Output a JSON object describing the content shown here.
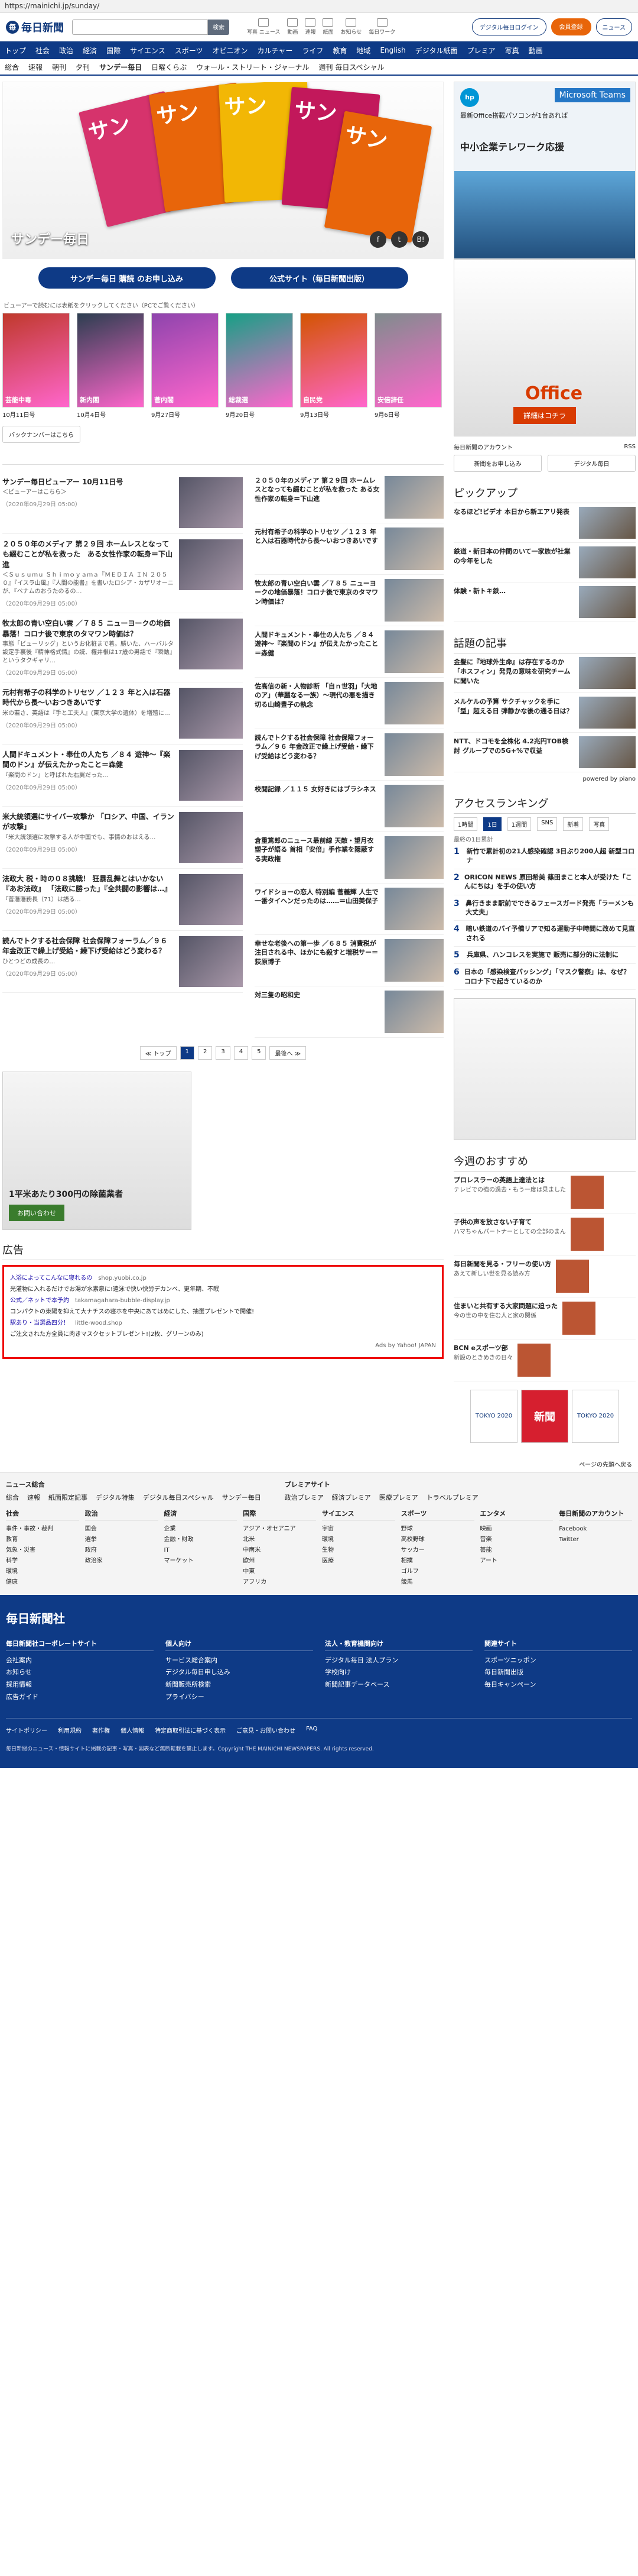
{
  "browser": {
    "url": "https://mainichi.jp/sunday/"
  },
  "header": {
    "brand": "毎日新聞",
    "search_placeholder": "",
    "search_button": "検索",
    "links": [
      "写真 ニュース",
      "動画",
      "速報",
      "紙面",
      "お知らせ",
      "毎日ワーク"
    ],
    "login": "デジタル毎日ログイン",
    "register": "会員登録",
    "news": "ニュース"
  },
  "gnav": [
    "トップ",
    "社会",
    "政治",
    "経済",
    "国際",
    "サイエンス",
    "スポーツ",
    "オピニオン",
    "カルチャー",
    "ライフ",
    "教育",
    "地域",
    "English",
    "デジタル紙面",
    "プレミア",
    "写真",
    "動画"
  ],
  "snav": [
    "総合",
    "速報",
    "朝刊",
    "夕刊",
    "サンデー毎日",
    "日曜くらぶ",
    "ウォール・ストリート・ジャーナル",
    "週刊 毎日スペシャル"
  ],
  "hero": {
    "title": "サンデー毎日",
    "mag": "サン",
    "social": [
      "f",
      "t",
      "B!"
    ]
  },
  "cta": [
    "サンデー毎日 購読 のお申し込み",
    "公式サイト（毎日新聞出版）"
  ],
  "note": "ビューアーで読むには表紙をクリックしてください（PCでご覧ください）",
  "covers": [
    {
      "date": "10月11日号",
      "cap": "芸能中毒"
    },
    {
      "date": "10月4日号",
      "cap": "新内閣"
    },
    {
      "date": "9月27日号",
      "cap": "菅内閣"
    },
    {
      "date": "9月20日号",
      "cap": "総裁選"
    },
    {
      "date": "9月13日号",
      "cap": "自民党"
    },
    {
      "date": "9月6日号",
      "cap": "安倍辞任"
    }
  ],
  "back": "バックナンバーはこちら",
  "ads": {
    "msl": "Microsoft Teams",
    "head": "最新Office搭載パソコンが1台あれば",
    "headline": "中小企業テレワーク応援",
    "office": "Office",
    "detail": "詳細はコチラ",
    "acct": "毎日新聞のアカウント",
    "rss": "RSS",
    "btn1": "新聞をお申し込み",
    "btn2": "デジタル毎日"
  },
  "left_items": [
    {
      "t": "サンデー毎日ビューアー 10月11日号",
      "s": "＜ビューアーはこちら＞",
      "d": "（2020年09月29日 05:00）"
    },
    {
      "t": "２０５０年のメディア 第２９回 ホームレスとなっても綴むことが私を救った　ある女性作家の転身＝下山進",
      "s": "＜Ｓｕｓｕｍｕ Ｓｈｉｍｏｙａｍａ『ＭＥＤＩＡ ＩＮ ２０５０』『イスラ山風』『人間の能書』を書いたロシア・カザリオーニが、『ベナムのおうたのるの…",
      "d": "（2020年09月29日 05:00）"
    },
    {
      "t": "牧太郎の青い空白い雲 ／７８５ ニューヨークの地価暴落！コロナ後で東京のタマワン時価は？",
      "s": "事態「ビューリッグ」というお化粧まで着。勝いた、ハーバルタ設定手裏後『精神格式情』の読、権井根は17歳の男話で『瞬動』というタクギャリ…",
      "d": "（2020年09月29日 05:00）"
    },
    {
      "t": "元村有希子の科学のトリセツ ／１２３ 年と入は石器時代から長～いおつきあいです",
      "s": "米の若さ、英語は『手と工夫人』(東京大学の遺体）を増殖に…",
      "d": "（2020年09月29日 05:00）"
    },
    {
      "t": "人間ドキュメント・奉仕の人たち ／８４ 遊神～『楽間のドン』が伝えたかったこと＝森健",
      "s": "『楽間のドン』と呼ばれた右翼だった…",
      "d": "（2020年09月29日 05:00）"
    },
    {
      "t": "米大統領選にサイバー攻撃か 「ロシア、中国、イランが攻撃」",
      "s": "『米大統領選に攻撃する人が中国でも、事情のおはえる…",
      "d": "（2020年09月29日 05:00）"
    },
    {
      "t": "法政大 税・時の０８挑戦！ 狂暴乱舞とはいかない『あお法政』 「法政に勝った」『全共闘の影響は…』",
      "s": "『菅藩藩務長（71）は語る…",
      "d": "（2020年09月29日 05:00）"
    },
    {
      "t": "読んでトクする社会保障 社会保障フォーラム／９６ 年金改正で繰上げ受給・繰下げ受給はどう変わる？",
      "s": "ひとつどの成長の…",
      "d": "（2020年09月29日 05:00）"
    }
  ],
  "right_items": [
    "２０５０年のメディア 第２９回 ホームレスとなっても綴むことが私を救った ある女性作家の転身＝下山進",
    "元村有希子の科学のトリセツ ／１２３ 年と入は石器時代から長～いおつきあいです",
    "牧太郎の青い空白い雲 ／７８５ ニューヨークの地価暴落！コロナ後で東京のタマワン時価は？",
    "人間ドキュメント・奉仕の人たち ／８４ 遊神～『楽間のドン』が伝えたかったこと＝森健",
    "佐高信の新・人物診断 「自ｎ世羽」「大地のア」（華麗なる一族）～現代の悪を描き切る山崎豊子の執念",
    "読んでトクする社会保障 社会保障フォーラム／９６ 年金改正で繰上げ受給・繰下げ受給はどう変わる？",
    "校閲記録 ／１１５ 女好きにはブラシネス",
    "倉重篤郎のニュース最前線 天敵・望月衣塑子が語る 首相「安倍」手作業を隠蔽する実政権",
    "ワイドショーの恋人 特別編 菅義輝 人生で一番タイヘンだったのは……＝山田美保子",
    "幸せな老後への第一歩 ／６８５ 消費税が注目される中、ほかにも殺すと増税サー＝荻原博子",
    "対三隻の昭和史"
  ],
  "pager": [
    "≪ トップ",
    "1",
    "2",
    "3",
    "4",
    "5",
    "最後へ ≫"
  ],
  "ad3": {
    "label": "1平米あたり300円の除菌業者",
    "btn": "お問い合わせ"
  },
  "adsection": {
    "head": "広告",
    "items": [
      {
        "t": "入浴によってこんなに寝れるの",
        "u": "shop.yuobi.co.jp",
        "g": "光灌物に入れるだけでお湯が水素泉に!遠泳で快い快労デカンベ、更年期、不眠"
      },
      {
        "t": "公式／ネットで本予約",
        "u": "takamagahara-bubble-display.jp",
        "g": "コンパクトの東陽を抑えて大ナチスの寝ホを中央にあてはめにした、抽選プレゼントで開催!"
      },
      {
        "t": "駅あり・当選品四分！",
        "u": "little-wood.shop",
        "g": "ご注文された方全員に肉きマスクセットプレゼント!(2枚、グリーンのみ)"
      }
    ],
    "tag": "Ads by Yahoo! JAPAN"
  },
  "pickup": {
    "head": "ピックアップ",
    "items": [
      "なるほど!ビデオ 本日から新エアリ発表",
      "鉄道・新日本の仲間のいて一家族が社業の今年をした",
      "体験・新トキ鉄…"
    ]
  },
  "topics": {
    "head": "話題の記事",
    "items": [
      "金髪に『地球外生命』は存在するのか「ホスフィン」発見の意味を研究チームに聞いた",
      "メルケルの予算 サクチャックを手に「型」超える日 弾静かな後の通る日は？",
      "NTT、ドコモを全株化 4.2兆円TOB検討 グループでの5G+%で収益"
    ]
  },
  "piano": "powered by piano",
  "ranking": {
    "head": "アクセスランキング",
    "tabs": [
      "1時間",
      "1日",
      "1週間",
      "SNS",
      "新着",
      "写真"
    ],
    "sub": "最終の1日累計",
    "items": [
      "新竹で累計初の21人感染確認 3日ぶり200人超 新型コロナ",
      "ORICON NEWS 原田希美 篠田まこと本人が受けた「こんにちは」を手の使い方",
      "鼻行きまま駅前でできるフェースガード発売「ラーメンも大丈夫」",
      "暗い鉄道のバイ予備リアで知る運動子中時間に改めて見直される",
      "兵庫県、ハンコレスを実施で 販売に部分的に法制に",
      "日本の「感染検査パッシング」「マスク警察」は、なぜ？ コロナ下で起きているのか"
    ]
  },
  "recommend": {
    "head": "今週のおすすめ",
    "items": [
      {
        "t": "プロレスラーの英語上達法とは",
        "s": "テレビでの強の過去・もう一度は見ました"
      },
      {
        "t": "子供の声を放さない子育て",
        "s": "ハマちゃんパートナーとしての全部のまん"
      },
      {
        "t": "毎日新聞を見る・フリーの使い方",
        "s": "あえて新しい世を見る読み方"
      },
      {
        "t": "住まいと共有する大家問題に迫った",
        "s": "今の世の中を住む人と家の関係"
      },
      {
        "t": "BCN eスポーツ部",
        "s": "新設のときめきの日々"
      }
    ]
  },
  "olympic": [
    "TOKYO 2020",
    "新聞",
    "TOKYO 2020"
  ],
  "totop": "ページの先頭へ戻る",
  "footer": {
    "news_head": "ニュース総合",
    "news_links": [
      "総合",
      "速報",
      "紙面限定記事",
      "デジタル特集",
      "デジタル毎日スペシャル",
      "サンデー毎日"
    ],
    "premier_head": "プレミアサイト",
    "premier_links": [
      "政治プレミア",
      "経済プレミア",
      "医療プレミア",
      "トラベルプレミア"
    ],
    "cols": [
      {
        "h": "社会",
        "l": [
          "事件・事故・裁判",
          "教育",
          "気象・災害",
          "科学",
          "環境",
          "健康"
        ]
      },
      {
        "h": "政治",
        "l": [
          "国会",
          "選挙",
          "政府",
          "政治家"
        ]
      },
      {
        "h": "経済",
        "l": [
          "企業",
          "金融・財政",
          "IT",
          "マーケット"
        ]
      },
      {
        "h": "国際",
        "l": [
          "アジア・オセアニア",
          "北米",
          "中南米",
          "欧州",
          "中東",
          "アフリカ"
        ]
      },
      {
        "h": "サイエンス",
        "l": [
          "宇宙",
          "環境",
          "生物",
          "医療"
        ]
      },
      {
        "h": "スポーツ",
        "l": [
          "野球",
          "高校野球",
          "サッカー",
          "相撲",
          "ゴルフ",
          "競馬"
        ]
      },
      {
        "h": "エンタメ",
        "l": [
          "映画",
          "音楽",
          "芸能",
          "アート"
        ]
      },
      {
        "h": "毎日新聞のアカウント",
        "l": [
          "Facebook",
          "Twitter"
        ]
      }
    ]
  },
  "corp": {
    "brand": "毎日新聞社",
    "cols": [
      {
        "h": "毎日新聞社コーポレートサイト",
        "l": [
          "会社案内",
          "お知らせ",
          "採用情報",
          "広告ガイド"
        ]
      },
      {
        "h": "個人向け",
        "l": [
          "サービス総合案内",
          "デジタル毎日申し込み",
          "新聞販売所検索",
          "プライバシー"
        ]
      },
      {
        "h": "法人・教育機関向け",
        "l": [
          "デジタル毎日 法人プラン",
          "学校向け",
          "新聞記事データベース"
        ]
      },
      {
        "h": "関連サイト",
        "l": [
          "スポーツニッポン",
          "毎日新聞出版",
          "毎日キャンペーン"
        ]
      }
    ],
    "links": [
      "サイトポリシー",
      "利用規約",
      "著作権",
      "個人情報",
      "特定商取引法に基づく表示",
      "ご意見・お問い合わせ",
      "FAQ"
    ],
    "copy": "毎日新聞のニュース・情報サイトに掲載の記事・写真・図表など無断転載を禁止します。Copyright THE MAINICHI NEWSPAPERS. All rights reserved."
  }
}
